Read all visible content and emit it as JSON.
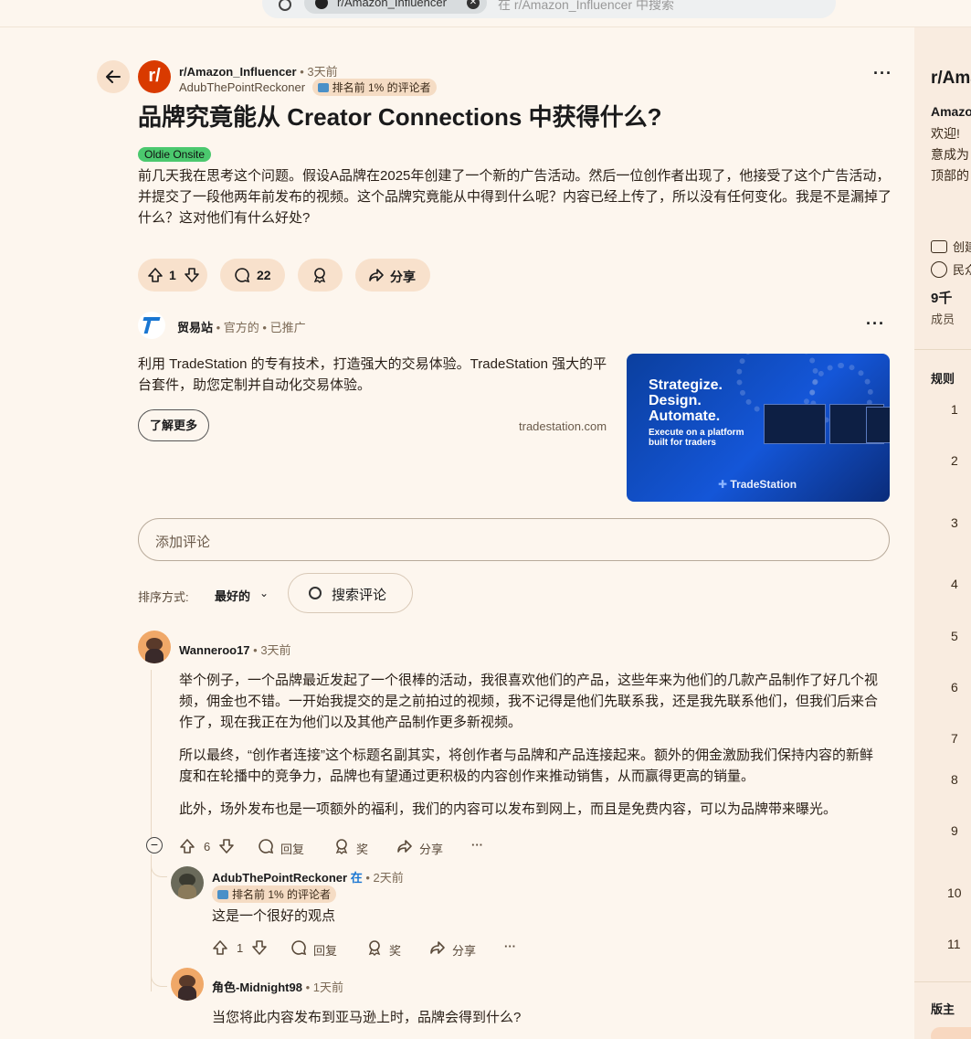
{
  "search": {
    "chip": "r/Amazon_Influencer",
    "placeholder": "在 r/Amazon_Influencer 中搜索"
  },
  "post": {
    "subreddit": "r/Amazon_Influencer",
    "time": "• 3天前",
    "author": "AdubThePointReckoner",
    "author_flair": "排名前 1% 的评论者",
    "title": "品牌究竟能从 Creator Connections 中获得什么?",
    "flair": "Oldie Onsite",
    "body": "前几天我在思考这个问题。假设A品牌在2025年创建了一个新的广告活动。然后一位创作者出现了，他接受了这个广告活动，并提交了一段他两年前发布的视频。这个品牌究竟能从中得到什么呢？内容已经上传了，所以没有任何变化。我是不是漏掉了什么？这对他们有什么好处?",
    "votes": "1",
    "comments": "22",
    "share": "分享"
  },
  "ad": {
    "name": "贸易站",
    "meta": "• 官方的 • 已推广",
    "text": "利用 TradeStation 的专有技术，打造强大的交易体验。TradeStation 强大的平台套件，助您定制并自动化交易体验。",
    "cta": "了解更多",
    "domain": "tradestation.com",
    "headline": "Strategize.\nDesign.\nAutomate.",
    "subline": "Execute on a platform built for traders",
    "brand": "TradeStation"
  },
  "comment_box": {
    "placeholder": "添加评论"
  },
  "sort": {
    "label": "排序方式:",
    "value": "最好的",
    "search": "搜索评论"
  },
  "comments": [
    {
      "author": "Wanneroo17",
      "time": "• 3天前",
      "paragraphs": [
        "举个例子，一个品牌最近发起了一个很棒的活动，我很喜欢他们的产品，这些年来为他们的几款产品制作了好几个视频，佣金也不错。一开始我提交的是之前拍过的视频，我不记得是他们先联系我，还是我先联系他们，但我们后来合作了，现在我正在为他们以及其他产品制作更多新视频。",
        "所以最终，“创作者连接”这个标题名副其实，将创作者与品牌和产品连接起来。额外的佣金激励我们保持内容的新鲜度和在轮播中的竞争力，品牌也有望通过更积极的内容创作来推动销售，从而赢得更高的销量。",
        "此外，场外发布也是一项额外的福利，我们的内容可以发布到网上，而且是免费内容，可以为品牌带来曝光。"
      ],
      "votes": "6",
      "reply": "回复",
      "award": "奖",
      "share": "分享",
      "collapse": "−"
    },
    {
      "author": "AdubThePointReckoner",
      "op_tag": "在",
      "time": "• 2天前",
      "flair": "排名前 1% 的评论者",
      "text": "这是一个很好的观点",
      "votes": "1",
      "reply": "回复",
      "award": "奖",
      "share": "分享"
    },
    {
      "author": "角色-Midnight98",
      "time": "• 1天前",
      "text": "当您将此内容发布到亚马逊上时，品牌会得到什么?"
    }
  ],
  "sidebar": {
    "title": "r/Amazon_Influencer",
    "subtitle": "Amazon Influencer",
    "desc_lines": [
      "欢迎!",
      "意成为",
      "顶部的"
    ],
    "created": "创建",
    "public": "民众",
    "members": "9千",
    "members_label": "成员",
    "rules_label": "规则",
    "rules": [
      "1",
      "2",
      "3",
      "4",
      "5",
      "6",
      "7",
      "8",
      "9",
      "10",
      "11"
    ],
    "mods_label": "版主"
  },
  "colors": {
    "background": "#fdf6ee",
    "pill": "#f8e1cc",
    "subreddit": "#d93a00",
    "oldie_flair": "#4bc86e"
  }
}
